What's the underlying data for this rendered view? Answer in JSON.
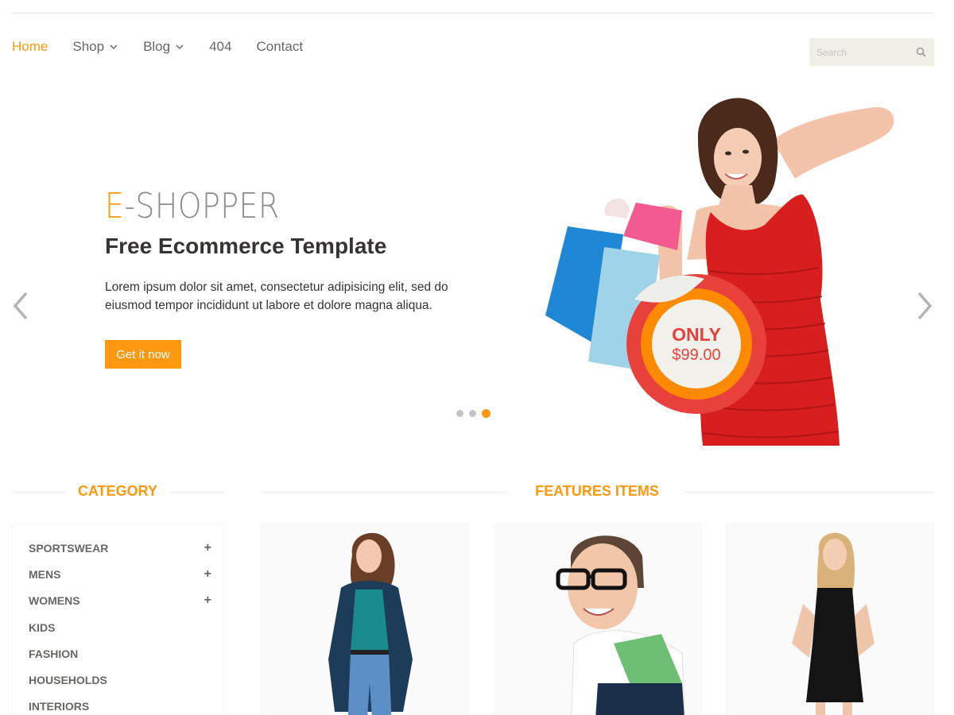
{
  "nav": {
    "items": [
      {
        "label": "Home",
        "active": true
      },
      {
        "label": "Shop",
        "dropdown": true
      },
      {
        "label": "Blog",
        "dropdown": true
      },
      {
        "label": "404"
      },
      {
        "label": "Contact"
      }
    ]
  },
  "search": {
    "placeholder": "Search",
    "icon": "search-icon"
  },
  "slider": {
    "brand_first": "E",
    "brand_rest": "-SHOPPER",
    "tagline": "Free Ecommerce Template",
    "description": "Lorem ipsum dolor sit amet, consectetur adipisicing elit, sed do eiusmod tempor incididunt ut labore et dolore magna aliqua.",
    "cta_label": "Get it now",
    "price_badge": {
      "top": "ONLY",
      "price": "$99.00"
    },
    "dots": 3,
    "active_dot": 3
  },
  "sections": {
    "category_title": "CATEGORY",
    "features_title": "FEATURES ITEMS"
  },
  "categories": [
    {
      "label": "SPORTSWEAR",
      "expandable": true
    },
    {
      "label": "MENS",
      "expandable": true
    },
    {
      "label": "WOMENS",
      "expandable": true
    },
    {
      "label": "KIDS",
      "expandable": false
    },
    {
      "label": "FASHION",
      "expandable": false
    },
    {
      "label": "HOUSEHOLDS",
      "expandable": false
    },
    {
      "label": "INTERIORS",
      "expandable": false
    }
  ],
  "colors": {
    "accent": "#FE980F",
    "text": "#696763",
    "heading": "#363432",
    "search_bg": "#F0F0E9"
  }
}
